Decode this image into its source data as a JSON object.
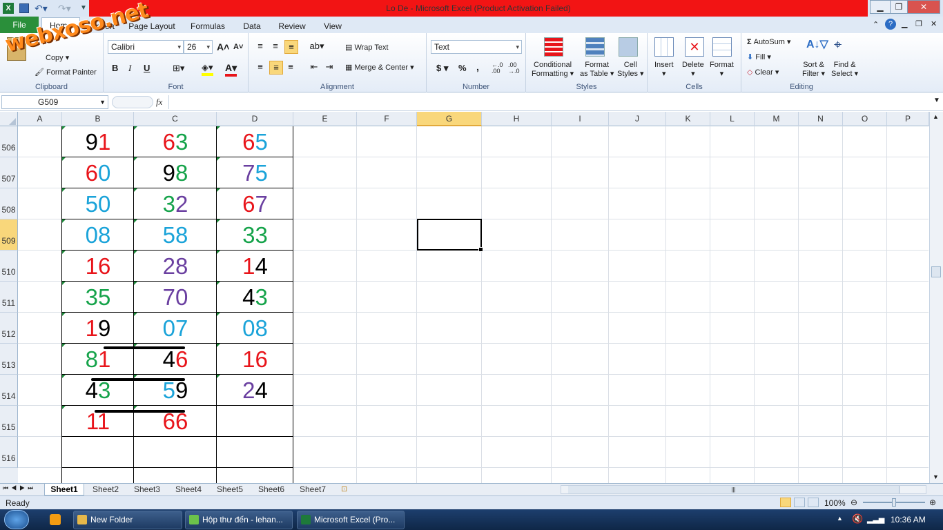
{
  "window": {
    "title": "Lo De  -  Microsoft Excel (Product Activation Failed)"
  },
  "qat": {
    "excel_icon": "excel-logo-icon",
    "save_icon": "save-icon",
    "undo_icon": "undo-icon",
    "redo_icon": "redo-icon",
    "customize_icon": "chevron-down-icon"
  },
  "win_controls": {
    "minimize": "▁",
    "restore": "❐",
    "close": "✕"
  },
  "tabs": {
    "file": "File",
    "home": "Home",
    "insert": "Insert",
    "page_layout": "Page Layout",
    "formulas": "Formulas",
    "data": "Data",
    "review": "Review",
    "view": "View"
  },
  "watermark": "webxoso.net",
  "ribbon": {
    "clipboard": {
      "label": "Clipboard",
      "copy": "Copy",
      "format_painter": "Format Painter"
    },
    "font": {
      "label": "Font",
      "name": "Calibri",
      "size": "26",
      "bold": "B",
      "italic": "I",
      "underline": "U"
    },
    "alignment": {
      "label": "Alignment",
      "wrap": "Wrap Text",
      "merge": "Merge & Center"
    },
    "number": {
      "label": "Number",
      "format": "Text",
      "currency": "$",
      "percent": "%",
      "comma": ","
    },
    "styles": {
      "label": "Styles",
      "conditional": "Conditional",
      "conditional2": "Formatting",
      "format_table": "Format",
      "format_table2": "as Table",
      "cell_styles": "Cell",
      "cell_styles2": "Styles"
    },
    "cells": {
      "label": "Cells",
      "insert": "Insert",
      "delete": "Delete",
      "format": "Format"
    },
    "editing": {
      "label": "Editing",
      "autosum": "AutoSum",
      "fill": "Fill",
      "clear": "Clear",
      "sort": "Sort &",
      "sort2": "Filter",
      "find": "Find &",
      "find2": "Select"
    }
  },
  "formula_bar": {
    "name_box": "G509",
    "fx": "fx",
    "value": ""
  },
  "columns": [
    "A",
    "B",
    "C",
    "D",
    "E",
    "F",
    "G",
    "H",
    "I",
    "J",
    "K",
    "L",
    "M",
    "N",
    "O",
    "P"
  ],
  "selected_column": "G",
  "rows": [
    "506",
    "507",
    "508",
    "509",
    "510",
    "511",
    "512",
    "513",
    "514",
    "515",
    "516"
  ],
  "selected_row": "509",
  "colors": {
    "red": "#e8141a",
    "black": "#000000",
    "green": "#15a34a",
    "cyan": "#1aa3d9",
    "purple": "#6a3fa0",
    "selected_header": "#f9d77b"
  },
  "cells": [
    {
      "row": "506",
      "col": "B",
      "digits": [
        {
          "d": "9",
          "c": "black"
        },
        {
          "d": "1",
          "c": "red"
        }
      ]
    },
    {
      "row": "506",
      "col": "C",
      "digits": [
        {
          "d": "6",
          "c": "red"
        },
        {
          "d": "3",
          "c": "green"
        }
      ]
    },
    {
      "row": "506",
      "col": "D",
      "digits": [
        {
          "d": "6",
          "c": "red"
        },
        {
          "d": "5",
          "c": "cyan"
        }
      ]
    },
    {
      "row": "507",
      "col": "B",
      "digits": [
        {
          "d": "6",
          "c": "red"
        },
        {
          "d": "0",
          "c": "cyan"
        }
      ]
    },
    {
      "row": "507",
      "col": "C",
      "digits": [
        {
          "d": "9",
          "c": "black"
        },
        {
          "d": "8",
          "c": "green"
        }
      ]
    },
    {
      "row": "507",
      "col": "D",
      "digits": [
        {
          "d": "7",
          "c": "purple"
        },
        {
          "d": "5",
          "c": "cyan"
        }
      ]
    },
    {
      "row": "508",
      "col": "B",
      "digits": [
        {
          "d": "5",
          "c": "cyan"
        },
        {
          "d": "0",
          "c": "cyan"
        }
      ]
    },
    {
      "row": "508",
      "col": "C",
      "digits": [
        {
          "d": "3",
          "c": "green"
        },
        {
          "d": "2",
          "c": "purple"
        }
      ]
    },
    {
      "row": "508",
      "col": "D",
      "digits": [
        {
          "d": "6",
          "c": "red"
        },
        {
          "d": "7",
          "c": "purple"
        }
      ]
    },
    {
      "row": "509",
      "col": "B",
      "digits": [
        {
          "d": "0",
          "c": "cyan"
        },
        {
          "d": "8",
          "c": "cyan"
        }
      ]
    },
    {
      "row": "509",
      "col": "C",
      "digits": [
        {
          "d": "5",
          "c": "cyan"
        },
        {
          "d": "8",
          "c": "cyan"
        }
      ]
    },
    {
      "row": "509",
      "col": "D",
      "digits": [
        {
          "d": "3",
          "c": "green"
        },
        {
          "d": "3",
          "c": "green"
        }
      ]
    },
    {
      "row": "510",
      "col": "B",
      "digits": [
        {
          "d": "1",
          "c": "red"
        },
        {
          "d": "6",
          "c": "red"
        }
      ]
    },
    {
      "row": "510",
      "col": "C",
      "digits": [
        {
          "d": "2",
          "c": "purple"
        },
        {
          "d": "8",
          "c": "purple"
        }
      ]
    },
    {
      "row": "510",
      "col": "D",
      "digits": [
        {
          "d": "1",
          "c": "red"
        },
        {
          "d": "4",
          "c": "black"
        }
      ]
    },
    {
      "row": "511",
      "col": "B",
      "digits": [
        {
          "d": "3",
          "c": "green"
        },
        {
          "d": "5",
          "c": "green"
        }
      ]
    },
    {
      "row": "511",
      "col": "C",
      "digits": [
        {
          "d": "7",
          "c": "purple"
        },
        {
          "d": "0",
          "c": "purple"
        }
      ]
    },
    {
      "row": "511",
      "col": "D",
      "digits": [
        {
          "d": "4",
          "c": "black"
        },
        {
          "d": "3",
          "c": "green"
        }
      ]
    },
    {
      "row": "512",
      "col": "B",
      "digits": [
        {
          "d": "1",
          "c": "red"
        },
        {
          "d": "9",
          "c": "black"
        }
      ]
    },
    {
      "row": "512",
      "col": "C",
      "digits": [
        {
          "d": "0",
          "c": "cyan"
        },
        {
          "d": "7",
          "c": "cyan"
        }
      ]
    },
    {
      "row": "512",
      "col": "D",
      "digits": [
        {
          "d": "0",
          "c": "cyan"
        },
        {
          "d": "8",
          "c": "cyan"
        }
      ]
    },
    {
      "row": "513",
      "col": "B",
      "digits": [
        {
          "d": "8",
          "c": "green"
        },
        {
          "d": "1",
          "c": "red"
        }
      ]
    },
    {
      "row": "513",
      "col": "C",
      "digits": [
        {
          "d": "4",
          "c": "black"
        },
        {
          "d": "6",
          "c": "red"
        }
      ]
    },
    {
      "row": "513",
      "col": "D",
      "digits": [
        {
          "d": "1",
          "c": "red"
        },
        {
          "d": "6",
          "c": "red"
        }
      ]
    },
    {
      "row": "514",
      "col": "B",
      "digits": [
        {
          "d": "4",
          "c": "black"
        },
        {
          "d": "3",
          "c": "green"
        }
      ]
    },
    {
      "row": "514",
      "col": "C",
      "digits": [
        {
          "d": "5",
          "c": "cyan"
        },
        {
          "d": "9",
          "c": "black"
        }
      ]
    },
    {
      "row": "514",
      "col": "D",
      "digits": [
        {
          "d": "2",
          "c": "purple"
        },
        {
          "d": "4",
          "c": "black"
        }
      ]
    },
    {
      "row": "515",
      "col": "B",
      "digits": [
        {
          "d": "1",
          "c": "red"
        },
        {
          "d": "1",
          "c": "red"
        }
      ]
    },
    {
      "row": "515",
      "col": "C",
      "digits": [
        {
          "d": "6",
          "c": "red"
        },
        {
          "d": "6",
          "c": "red"
        }
      ]
    }
  ],
  "sheets": [
    "Sheet1",
    "Sheet2",
    "Sheet3",
    "Sheet4",
    "Sheet5",
    "Sheet6",
    "Sheet7"
  ],
  "active_sheet": "Sheet1",
  "status": {
    "ready": "Ready",
    "zoom": "100%"
  },
  "taskbar": {
    "items": [
      "New Folder",
      "Hộp thư đến - lehan...",
      "Microsoft Excel (Pro..."
    ],
    "time": "10:36 AM"
  }
}
